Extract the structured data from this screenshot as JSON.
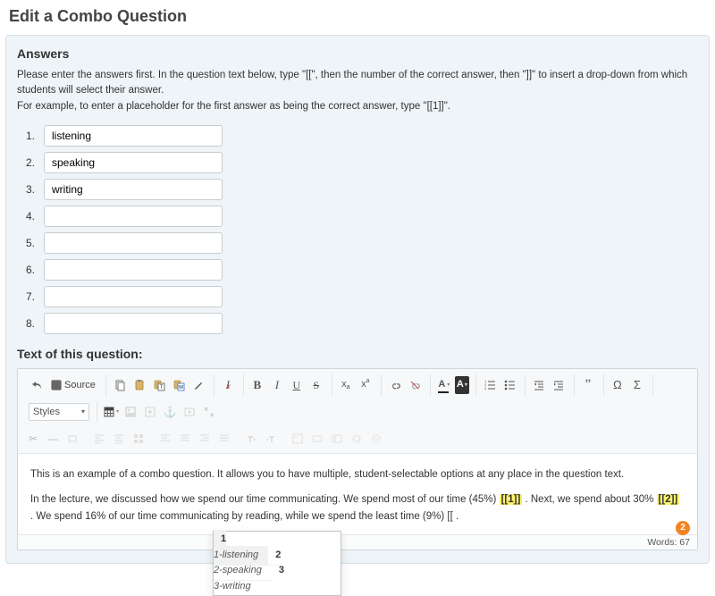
{
  "page_title": "Edit a Combo Question",
  "answers_section": {
    "heading": "Answers",
    "help_line1": "Please enter the answers first. In the question text below, type \"[[\", then the number of the correct answer, then \"]]\" to insert a drop-down from which students will select their answer.",
    "help_line2": "For example, to enter a placeholder for the first answer as being the correct answer, type \"[[1]]\".",
    "rows": [
      {
        "n": "1.",
        "v": "listening"
      },
      {
        "n": "2.",
        "v": "speaking"
      },
      {
        "n": "3.",
        "v": "writing"
      },
      {
        "n": "4.",
        "v": ""
      },
      {
        "n": "5.",
        "v": ""
      },
      {
        "n": "6.",
        "v": ""
      },
      {
        "n": "7.",
        "v": ""
      },
      {
        "n": "8.",
        "v": ""
      }
    ]
  },
  "question_section": {
    "heading": "Text of this question:"
  },
  "toolbar": {
    "source_label": "Source",
    "styles_label": "Styles"
  },
  "editor_body": {
    "p1": "This is an example of a combo question. It allows you to have multiple, student-selectable options at any place in the question text.",
    "p2a": "In the lecture, we discussed how we spend our time communicating. We spend most of our time (45%) ",
    "ph1": "[[1]]",
    "p2b": " . Next, we spend about 30% ",
    "ph2": "[[2]]",
    "p2c": " . We spend 16% of our time communicating by reading, while we spend the least time (9%) ",
    "p2d": "[[",
    "p2e": " ."
  },
  "dropdown": {
    "items": [
      {
        "num": "1",
        "label": "1-listening"
      },
      {
        "num": "2",
        "label": "2-speaking"
      },
      {
        "num": "3",
        "label": "3-writing"
      }
    ]
  },
  "badge": "2",
  "footer": {
    "words": "Words: 67"
  }
}
